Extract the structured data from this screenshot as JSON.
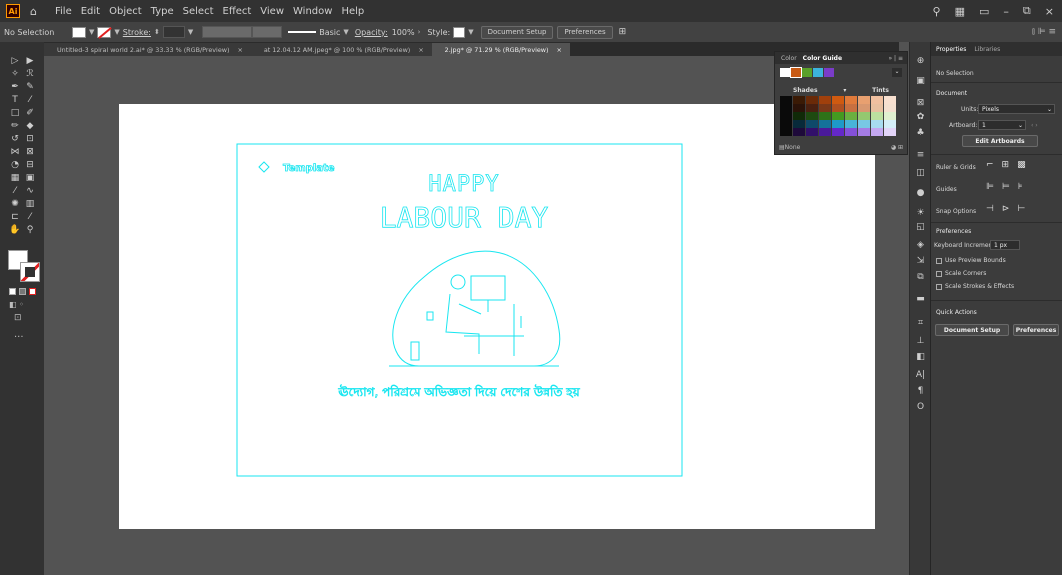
{
  "app": {
    "logo": "Ai",
    "home_icon": "home-icon"
  },
  "menu": [
    "File",
    "Edit",
    "Object",
    "Type",
    "Select",
    "Effect",
    "View",
    "Window",
    "Help"
  ],
  "window_controls": {
    "minimize": "–",
    "restore": "⧉",
    "close": "×",
    "search_icon": "search-icon"
  },
  "control_bar": {
    "selection": "No Selection",
    "stroke_label": "Stroke:",
    "stroke_value": "",
    "stroke_profile": "Basic",
    "opacity_label": "Opacity:",
    "opacity_value": "100%",
    "style_label": "Style:",
    "document_setup": "Document Setup",
    "preferences": "Preferences"
  },
  "tabs": [
    {
      "label": "Untitled-3 spiral world 2.ai* @ 33.33 % (RGB/Preview)",
      "close": "×",
      "active": false
    },
    {
      "label": "at 12.04.12 AM.jpeg* @ 100 % (RGB/Preview)",
      "close": "×",
      "active": false
    },
    {
      "label": "2.jpg* @ 71.29 % (RGB/Preview)",
      "close": "×",
      "active": true
    }
  ],
  "artwork": {
    "template_label": "Template",
    "line1": "HAPPY",
    "line2": "LABOUR DAY",
    "bottom_text": "ঊদ্যোগ, পরিশ্রমে অভিজ্ঞতা দিয়ে দেশের উন্নতি হয়",
    "outline_color": "#19e6f0"
  },
  "color_guide": {
    "tab_color": "Color",
    "tab_guide": "Color Guide",
    "shades": "Shades",
    "tints": "Tints",
    "harmony": [
      "#ffffff",
      "#c85a14",
      "#5aa02a",
      "#3cb4dc",
      "#7a3cc8"
    ],
    "grid_colors": [
      [
        "#0a0a0a",
        "#3a1a05",
        "#6a2a08",
        "#a0400c",
        "#d05a10",
        "#e07a3a",
        "#e8a070",
        "#f0c0a0",
        "#f8e0d0"
      ],
      [
        "#0a0a0a",
        "#2a1208",
        "#4a2010",
        "#7a3818",
        "#b05020",
        "#c87040",
        "#d89870",
        "#e8c0a0",
        "#f4e0d0"
      ],
      [
        "#0a0a0a",
        "#102a08",
        "#1e4a10",
        "#2e7218",
        "#449a20",
        "#6ab040",
        "#94c870",
        "#bce0a0",
        "#e0f0d0"
      ],
      [
        "#0a0a0a",
        "#082a3a",
        "#0e4a6a",
        "#14729a",
        "#1e9ac8",
        "#48b4d8",
        "#78c8e4",
        "#a8dcf0",
        "#d4eef8"
      ],
      [
        "#0a0a0a",
        "#1e0a3a",
        "#32106a",
        "#4a1a9a",
        "#6428c8",
        "#8450d8",
        "#a47ce4",
        "#c4a8f0",
        "#e2d4f8"
      ]
    ],
    "footer_none": "None"
  },
  "properties": {
    "tab_properties": "Properties",
    "tab_libraries": "Libraries",
    "no_selection": "No Selection",
    "document": "Document",
    "units_label": "Units:",
    "units_value": "Pixels",
    "artboard_label": "Artboard:",
    "artboard_value": "1",
    "edit_artboards": "Edit Artboards",
    "ruler_grids": "Ruler & Grids",
    "guides": "Guides",
    "snap_options": "Snap Options",
    "preferences": "Preferences",
    "kbd_increment_label": "Keyboard Increment:",
    "kbd_increment_value": "1 px",
    "use_preview_bounds": "Use Preview Bounds",
    "scale_corners": "Scale Corners",
    "scale_strokes": "Scale Strokes & Effects",
    "quick_actions": "Quick Actions",
    "document_setup": "Document Setup",
    "preferences_btn": "Preferences"
  }
}
